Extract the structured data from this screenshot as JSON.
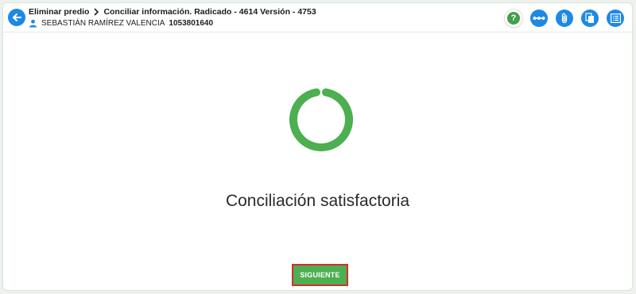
{
  "breadcrumb": {
    "parent": "Eliminar predio",
    "current": "Conciliar información. Radicado - 4614 Versión - 4753"
  },
  "user": {
    "name": "SEBASTIÁN RAMÍREZ VALENCIA",
    "id": "1053801640"
  },
  "header_actions": {
    "help_label": "?"
  },
  "main": {
    "message": "Conciliación satisfactoria",
    "button_label": "SIGUIENTE"
  },
  "colors": {
    "primary": "#1e88e5",
    "success": "#4caf50",
    "button_outline": "#d32f2f"
  }
}
